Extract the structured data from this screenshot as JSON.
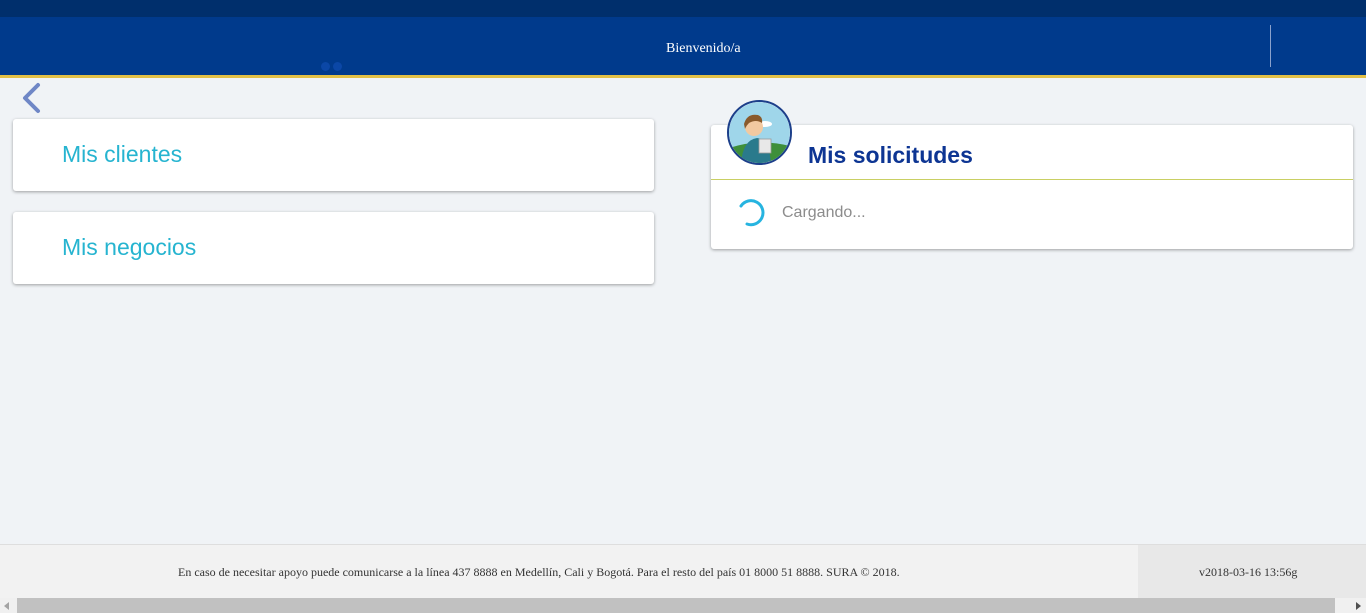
{
  "header": {
    "welcome": "Bienvenido/a",
    "brand_color": "#003a8c",
    "accent_color": "#e2c046"
  },
  "nav": {
    "back_icon": "chevron-left-icon"
  },
  "cards": {
    "clients": "Mis clientes",
    "business": "Mis negocios"
  },
  "requests": {
    "title": "Mis solicitudes",
    "avatar_icon": "person-avatar-icon",
    "loading_text": "Cargando..."
  },
  "footer": {
    "support_text": "En caso de necesitar apoyo puede comunicarse a la línea 437 8888 en Medellín, Cali y Bogotá. Para el resto del país 01 8000 51 8888. SURA © 2018.",
    "version": "v2018-03-16 13:56g"
  }
}
